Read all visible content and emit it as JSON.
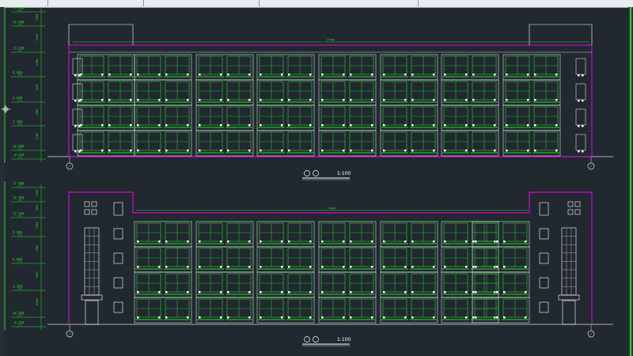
{
  "window": {
    "tabs": [
      "",
      "",
      "",
      "",
      ""
    ]
  },
  "drawing": {
    "upper_elevation": {
      "title_marker": "①-②",
      "scale": "1:100",
      "levels": [
        "17.800",
        "16.900",
        "13.500",
        "9.900",
        "6.600",
        "3.300",
        "±0.000",
        "-0.450"
      ],
      "dimension_top": "14400",
      "parapet_label": "17.800"
    },
    "lower_elevation": {
      "title_marker": "①-②",
      "scale": "1:100",
      "levels": [
        "17.800",
        "16.900",
        "13.500",
        "9.900",
        "6.600",
        "3.300",
        "±0.000",
        "-0.450"
      ],
      "dimension_top": "14400"
    }
  },
  "colors": {
    "background": "#212830",
    "outline": "#ff00ff",
    "frame": "#ffffff",
    "window_green": "#22dd22",
    "axis": "#dddddd"
  }
}
